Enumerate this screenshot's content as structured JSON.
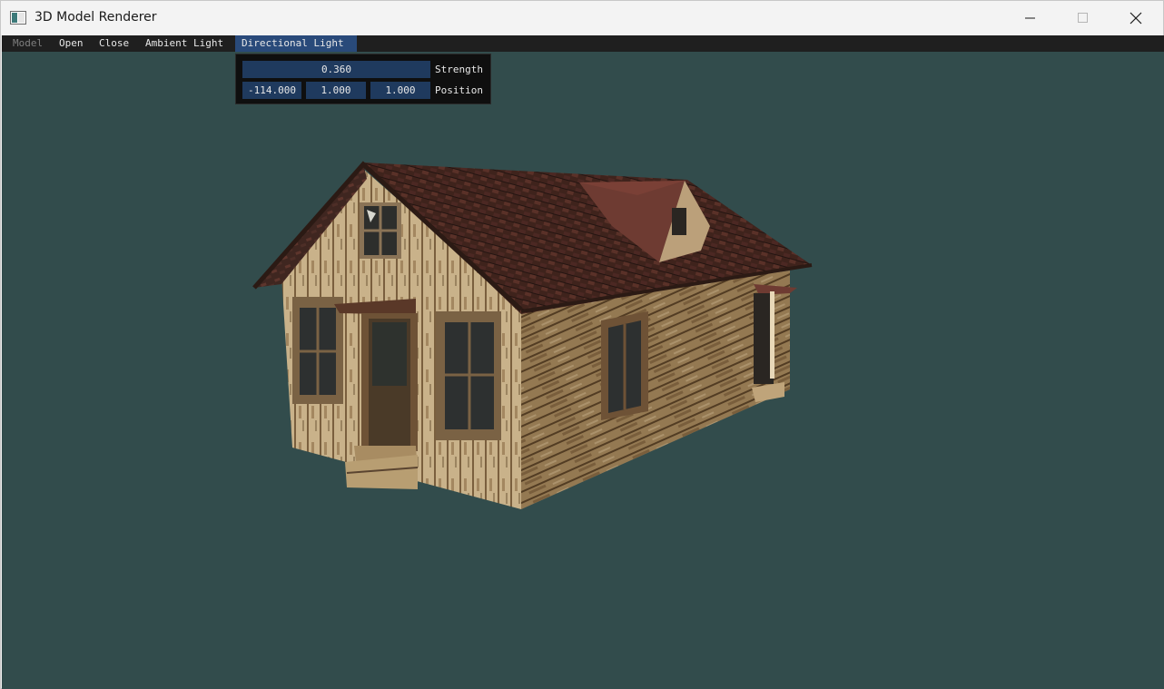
{
  "window": {
    "title": "3D Model Renderer"
  },
  "menu": {
    "items": [
      {
        "label": "Model",
        "state": "disabled"
      },
      {
        "label": "Open",
        "state": "normal"
      },
      {
        "label": "Close",
        "state": "normal"
      },
      {
        "label": "Ambient Light",
        "state": "normal"
      },
      {
        "label": "Directional Light",
        "state": "active"
      }
    ]
  },
  "directional_light": {
    "strength": "0.360",
    "strength_label": "Strength",
    "position": [
      "-114.000",
      "1.000",
      "1.000"
    ],
    "position_label": "Position"
  },
  "colors": {
    "viewport_background": "#324c4c",
    "menubar_background": "#1f1f1f",
    "active_menu": "#294a7a",
    "input_field": "#1f3a5e"
  },
  "icons": {
    "app": "app-window-icon",
    "minimize": "minimize-icon",
    "maximize": "maximize-icon",
    "close": "close-icon"
  }
}
